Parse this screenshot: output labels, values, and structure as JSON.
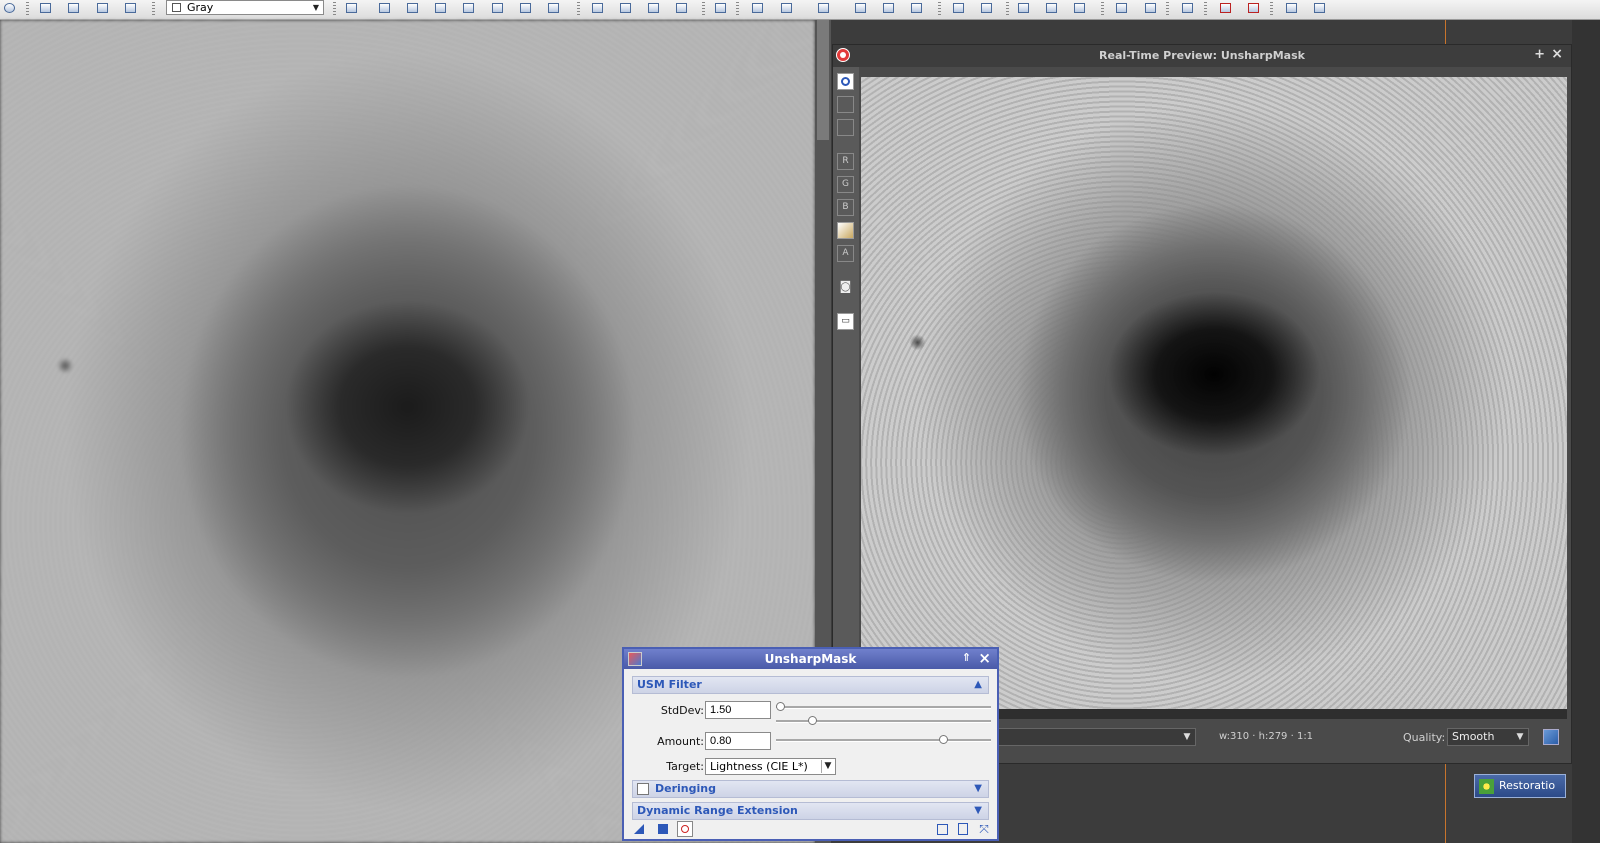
{
  "toolbar": {
    "view_select_value": "Gray"
  },
  "preview": {
    "title": "Real-Time Preview: UnsharpMask",
    "dims": "w:310 · h:279 · 1:1",
    "quality_label": "Quality:",
    "quality_value": "Smooth",
    "sidebar_buttons": [
      "R",
      "G",
      "B",
      "A"
    ]
  },
  "usm": {
    "title": "UnsharpMask",
    "section_usm": "USM Filter",
    "stddev_label": "StdDev:",
    "stddev_value": "1.50",
    "amount_label": "Amount:",
    "amount_value": "0.80",
    "target_label": "Target:",
    "target_value": "Lightness (CIE L*)",
    "section_deringing": "Deringing",
    "section_dre": "Dynamic Range Extension",
    "stddev_coarse_fraction": 0.0,
    "stddev_fine_fraction": 0.15,
    "amount_fraction": 0.76
  },
  "icons": {
    "restoration_label": "Restoratio"
  }
}
